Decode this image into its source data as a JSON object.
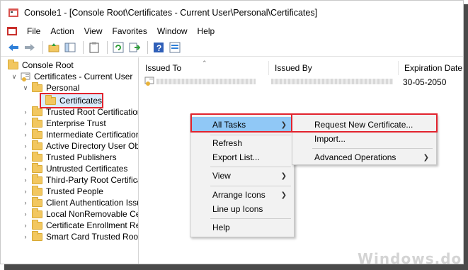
{
  "window": {
    "title": "Console1 - [Console Root\\Certificates - Current User\\Personal\\Certificates]"
  },
  "menu": {
    "items": [
      "File",
      "Action",
      "View",
      "Favorites",
      "Window",
      "Help"
    ]
  },
  "toolbar": {
    "icons": [
      "back-arrow-icon",
      "forward-arrow-icon",
      "up-folder-icon",
      "show-hide-tree-icon",
      "clipboard-icon",
      "refresh-icon",
      "export-icon",
      "help-icon",
      "properties-icon"
    ]
  },
  "tree": {
    "root": "Console Root",
    "certs_current_user": "Certificates - Current User",
    "personal": "Personal",
    "certificates": "Certificates",
    "stores": [
      "Trusted Root Certification /",
      "Enterprise Trust",
      "Intermediate Certification A",
      "Active Directory User Objec",
      "Trusted Publishers",
      "Untrusted Certificates",
      "Third-Party Root Certificatio",
      "Trusted People",
      "Client Authentication Issue",
      "Local NonRemovable Certi",
      "Certificate Enrollment Requ",
      "Smart Card Trusted Roots"
    ]
  },
  "list": {
    "columns": [
      "Issued To",
      "Issued By",
      "Expiration Date"
    ],
    "rows": [
      {
        "expiration": "30-05-2050"
      }
    ]
  },
  "context_menu": {
    "all_tasks": "All Tasks",
    "refresh": "Refresh",
    "export_list": "Export List...",
    "view": "View",
    "arrange_icons": "Arrange Icons",
    "line_up_icons": "Line up Icons",
    "help": "Help"
  },
  "submenu": {
    "request_new": "Request New Certificate...",
    "import": "Import...",
    "advanced": "Advanced Operations"
  },
  "colors": {
    "highlight_red": "#e2232e",
    "menu_hover": "#90c8f6",
    "folder": "#f2c760"
  },
  "watermark": "Windows.do"
}
